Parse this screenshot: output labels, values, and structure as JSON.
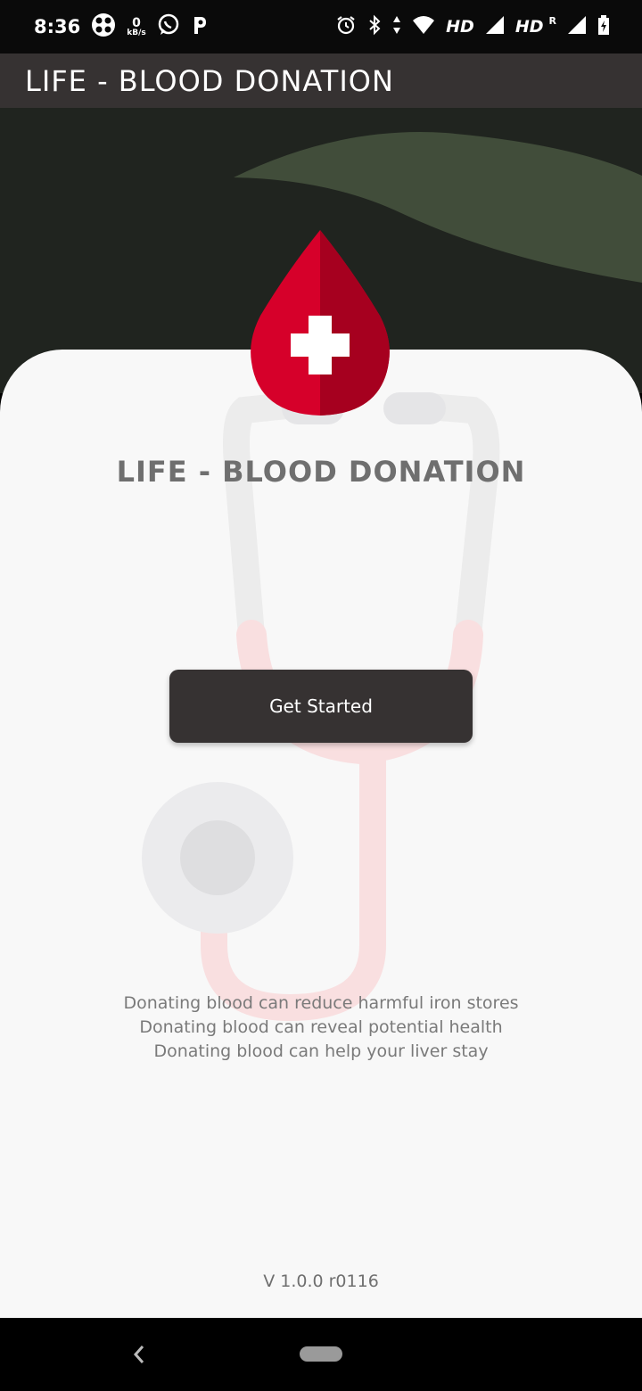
{
  "status_bar": {
    "time": "8:36",
    "net_speed_value": "0",
    "net_speed_unit": "kB/s",
    "hd_1": "HD",
    "hd_2": "HD",
    "roaming": "R",
    "icons": [
      "app-icon",
      "whatsapp-icon",
      "p-icon",
      "alarm-icon",
      "bluetooth-icon",
      "data-arrows-icon",
      "wifi-icon",
      "signal-icon",
      "signal-icon",
      "battery-charging-icon"
    ]
  },
  "app_bar": {
    "title": "LIFE - BLOOD DONATION"
  },
  "main": {
    "title": "LIFE - BLOOD DONATION",
    "cta_label": "Get Started",
    "facts": [
      "Donating blood can reduce harmful iron stores",
      "Donating blood can reveal potential health",
      "Donating blood can help your liver stay"
    ],
    "version": "V 1.0.0 r0116"
  },
  "colors": {
    "app_bar": "#363232",
    "hero_dark": "#20241f",
    "hero_leaf": "#414d3a",
    "card": "#f8f8f8",
    "drop_red": "#d6002a",
    "drop_shadow": "#a6001f",
    "button": "#363232"
  },
  "nav_bar": {
    "icons": [
      "back-icon",
      "home-pill-icon"
    ]
  }
}
